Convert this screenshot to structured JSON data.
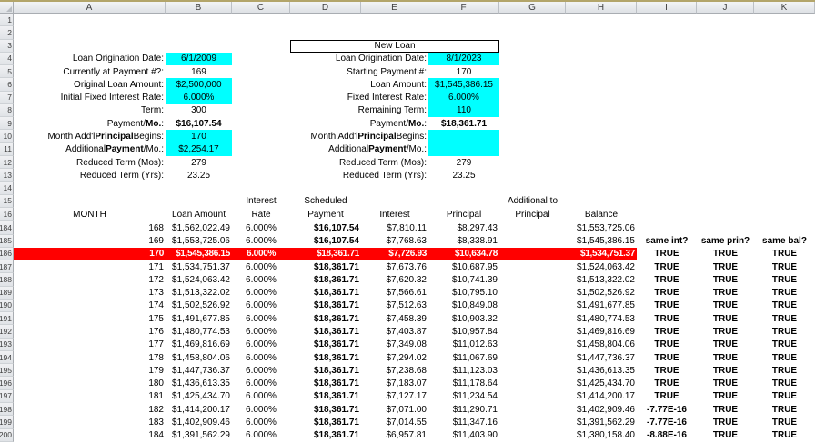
{
  "colors": {
    "highlight_cyan": "#00FFFF",
    "highlight_red": "#FF0000",
    "red_row_text": "#FFFFFF"
  },
  "grid_columns": [
    "A",
    "B",
    "C",
    "D",
    "E",
    "F",
    "G",
    "H",
    "I",
    "J",
    "K"
  ],
  "form_rows": [
    {
      "n": "1"
    },
    {
      "n": "2"
    },
    {
      "n": "3",
      "cells": [
        {
          "col": "D",
          "span": 3,
          "t": "New Loan",
          "align": "c",
          "box": true
        }
      ]
    },
    {
      "n": "4",
      "cells": [
        {
          "col": "A",
          "t": "Loan Origination Date:",
          "align": "r"
        },
        {
          "col": "B",
          "t": "6/1/2009",
          "align": "c",
          "bg": "cyan"
        },
        {
          "col": "D",
          "span": 2,
          "t": "Loan Origination Date:",
          "align": "r"
        },
        {
          "col": "F",
          "t": "8/1/2023",
          "align": "c",
          "bg": "cyan"
        }
      ]
    },
    {
      "n": "5",
      "cells": [
        {
          "col": "A",
          "t": "Currently at Payment #?:",
          "align": "r"
        },
        {
          "col": "B",
          "t": "169",
          "align": "c"
        },
        {
          "col": "D",
          "span": 2,
          "t": "Starting Payment #:",
          "align": "r"
        },
        {
          "col": "F",
          "t": "170",
          "align": "c"
        }
      ]
    },
    {
      "n": "6",
      "cells": [
        {
          "col": "A",
          "t": "Original Loan Amount:",
          "align": "r"
        },
        {
          "col": "B",
          "t": "$2,500,000",
          "align": "c",
          "bg": "cyan"
        },
        {
          "col": "D",
          "span": 2,
          "t": "Loan Amount:",
          "align": "r"
        },
        {
          "col": "F",
          "t": "$1,545,386.15",
          "align": "c",
          "bg": "cyan"
        }
      ]
    },
    {
      "n": "7",
      "cells": [
        {
          "col": "A",
          "t": "Initial Fixed Interest Rate:",
          "align": "r"
        },
        {
          "col": "B",
          "t": "6.000%",
          "align": "c",
          "bg": "cyan"
        },
        {
          "col": "D",
          "span": 2,
          "t": "Fixed Interest Rate:",
          "align": "r"
        },
        {
          "col": "F",
          "t": "6.000%",
          "align": "c",
          "bg": "cyan"
        }
      ]
    },
    {
      "n": "8",
      "cells": [
        {
          "col": "A",
          "t": "Term:",
          "align": "r"
        },
        {
          "col": "B",
          "t": "300",
          "align": "c"
        },
        {
          "col": "D",
          "span": 2,
          "t": "Remaining Term:",
          "align": "r"
        },
        {
          "col": "F",
          "t": "110",
          "align": "c",
          "bg": "cyan"
        }
      ]
    },
    {
      "n": "9",
      "cells": [
        {
          "col": "A",
          "parts": [
            {
              "t": "Payment/"
            },
            {
              "t": "Mo.",
              "b": true
            },
            {
              "t": ":"
            }
          ],
          "align": "r"
        },
        {
          "col": "B",
          "t": "$16,107.54",
          "align": "c",
          "bold": true
        },
        {
          "col": "D",
          "span": 2,
          "parts": [
            {
              "t": "Payment/"
            },
            {
              "t": "Mo.",
              "b": true
            },
            {
              "t": ":"
            }
          ],
          "align": "r"
        },
        {
          "col": "F",
          "t": "$18,361.71",
          "align": "c",
          "bold": true
        }
      ]
    },
    {
      "n": "10",
      "cells": [
        {
          "col": "A",
          "parts": [
            {
              "t": "Month Add'l "
            },
            {
              "t": "Principal",
              "b": true
            },
            {
              "t": " Begins:"
            }
          ],
          "align": "r"
        },
        {
          "col": "B",
          "t": "170",
          "align": "c",
          "bg": "cyan"
        },
        {
          "col": "D",
          "span": 2,
          "parts": [
            {
              "t": "Month Add'l "
            },
            {
              "t": "Principal",
              "b": true
            },
            {
              "t": " Begins:"
            }
          ],
          "align": "r"
        },
        {
          "col": "F",
          "t": "",
          "align": "c",
          "bg": "cyan"
        }
      ]
    },
    {
      "n": "11",
      "cells": [
        {
          "col": "A",
          "parts": [
            {
              "t": "Additional "
            },
            {
              "t": "Payment",
              "b": true
            },
            {
              "t": "/Mo.:"
            }
          ],
          "align": "r"
        },
        {
          "col": "B",
          "t": "$2,254.17",
          "align": "c",
          "bg": "cyan"
        },
        {
          "col": "D",
          "span": 2,
          "parts": [
            {
              "t": "Additional "
            },
            {
              "t": "Payment",
              "b": true
            },
            {
              "t": "/Mo.:"
            }
          ],
          "align": "r"
        },
        {
          "col": "F",
          "t": "",
          "align": "c",
          "bg": "cyan"
        }
      ]
    },
    {
      "n": "12",
      "cells": [
        {
          "col": "A",
          "t": "Reduced Term (Mos):",
          "align": "r"
        },
        {
          "col": "B",
          "t": "279",
          "align": "c"
        },
        {
          "col": "D",
          "span": 2,
          "t": "Reduced Term (Mos):",
          "align": "r"
        },
        {
          "col": "F",
          "t": "279",
          "align": "c"
        }
      ]
    },
    {
      "n": "13",
      "cells": [
        {
          "col": "A",
          "t": "Reduced Term (Yrs):",
          "align": "r"
        },
        {
          "col": "B",
          "t": "23.25",
          "align": "c"
        },
        {
          "col": "D",
          "span": 2,
          "t": "Reduced Term (Yrs):",
          "align": "r"
        },
        {
          "col": "F",
          "t": "23.25",
          "align": "c"
        }
      ]
    },
    {
      "n": "14"
    },
    {
      "n": "15",
      "cells": [
        {
          "col": "C",
          "t": "Interest",
          "align": "c"
        },
        {
          "col": "D",
          "t": "Scheduled",
          "align": "c"
        },
        {
          "col": "G",
          "t": "Additional to",
          "align": "c"
        }
      ]
    },
    {
      "n": "16",
      "cells": [
        {
          "col": "A",
          "t": "MONTH",
          "align": "c"
        },
        {
          "col": "B",
          "t": "Loan Amount",
          "align": "c"
        },
        {
          "col": "C",
          "t": "Rate",
          "align": "c"
        },
        {
          "col": "D",
          "t": "Payment",
          "align": "c"
        },
        {
          "col": "E",
          "t": "Interest",
          "align": "c"
        },
        {
          "col": "F",
          "t": "Principal",
          "align": "c"
        },
        {
          "col": "G",
          "t": "Principal",
          "align": "c"
        },
        {
          "col": "H",
          "t": "Balance",
          "align": "c"
        }
      ]
    }
  ],
  "amortization_rows": [
    {
      "n": "184",
      "month": "168",
      "loan": "$1,562,022.49",
      "rate": "6.000%",
      "payment": "$16,107.54",
      "interest": "$7,810.11",
      "principal": "$8,297.43",
      "balance": "$1,553,725.06",
      "same_int": "",
      "same_prin": "",
      "same_bal": ""
    },
    {
      "n": "185",
      "month": "169",
      "loan": "$1,553,725.06",
      "rate": "6.000%",
      "payment": "$16,107.54",
      "interest": "$7,768.63",
      "principal": "$8,338.91",
      "balance": "$1,545,386.15",
      "same_int": "same int?",
      "same_prin": "same prin?",
      "same_bal": "same bal?"
    },
    {
      "n": "186",
      "highlight": true,
      "month": "170",
      "loan": "$1,545,386.15",
      "rate": "6.000%",
      "payment": "$18,361.71",
      "interest": "$7,726.93",
      "principal": "$10,634.78",
      "balance": "$1,534,751.37",
      "same_int": "TRUE",
      "same_prin": "TRUE",
      "same_bal": "TRUE"
    },
    {
      "n": "187",
      "month": "171",
      "loan": "$1,534,751.37",
      "rate": "6.000%",
      "payment": "$18,361.71",
      "interest": "$7,673.76",
      "principal": "$10,687.95",
      "balance": "$1,524,063.42",
      "same_int": "TRUE",
      "same_prin": "TRUE",
      "same_bal": "TRUE"
    },
    {
      "n": "188",
      "month": "172",
      "loan": "$1,524,063.42",
      "rate": "6.000%",
      "payment": "$18,361.71",
      "interest": "$7,620.32",
      "principal": "$10,741.39",
      "balance": "$1,513,322.02",
      "same_int": "TRUE",
      "same_prin": "TRUE",
      "same_bal": "TRUE"
    },
    {
      "n": "189",
      "month": "173",
      "loan": "$1,513,322.02",
      "rate": "6.000%",
      "payment": "$18,361.71",
      "interest": "$7,566.61",
      "principal": "$10,795.10",
      "balance": "$1,502,526.92",
      "same_int": "TRUE",
      "same_prin": "TRUE",
      "same_bal": "TRUE"
    },
    {
      "n": "190",
      "month": "174",
      "loan": "$1,502,526.92",
      "rate": "6.000%",
      "payment": "$18,361.71",
      "interest": "$7,512.63",
      "principal": "$10,849.08",
      "balance": "$1,491,677.85",
      "same_int": "TRUE",
      "same_prin": "TRUE",
      "same_bal": "TRUE"
    },
    {
      "n": "191",
      "month": "175",
      "loan": "$1,491,677.85",
      "rate": "6.000%",
      "payment": "$18,361.71",
      "interest": "$7,458.39",
      "principal": "$10,903.32",
      "balance": "$1,480,774.53",
      "same_int": "TRUE",
      "same_prin": "TRUE",
      "same_bal": "TRUE"
    },
    {
      "n": "192",
      "month": "176",
      "loan": "$1,480,774.53",
      "rate": "6.000%",
      "payment": "$18,361.71",
      "interest": "$7,403.87",
      "principal": "$10,957.84",
      "balance": "$1,469,816.69",
      "same_int": "TRUE",
      "same_prin": "TRUE",
      "same_bal": "TRUE"
    },
    {
      "n": "193",
      "month": "177",
      "loan": "$1,469,816.69",
      "rate": "6.000%",
      "payment": "$18,361.71",
      "interest": "$7,349.08",
      "principal": "$11,012.63",
      "balance": "$1,458,804.06",
      "same_int": "TRUE",
      "same_prin": "TRUE",
      "same_bal": "TRUE"
    },
    {
      "n": "194",
      "month": "178",
      "loan": "$1,458,804.06",
      "rate": "6.000%",
      "payment": "$18,361.71",
      "interest": "$7,294.02",
      "principal": "$11,067.69",
      "balance": "$1,447,736.37",
      "same_int": "TRUE",
      "same_prin": "TRUE",
      "same_bal": "TRUE"
    },
    {
      "n": "195",
      "month": "179",
      "loan": "$1,447,736.37",
      "rate": "6.000%",
      "payment": "$18,361.71",
      "interest": "$7,238.68",
      "principal": "$11,123.03",
      "balance": "$1,436,613.35",
      "same_int": "TRUE",
      "same_prin": "TRUE",
      "same_bal": "TRUE"
    },
    {
      "n": "196",
      "month": "180",
      "loan": "$1,436,613.35",
      "rate": "6.000%",
      "payment": "$18,361.71",
      "interest": "$7,183.07",
      "principal": "$11,178.64",
      "balance": "$1,425,434.70",
      "same_int": "TRUE",
      "same_prin": "TRUE",
      "same_bal": "TRUE"
    },
    {
      "n": "197",
      "month": "181",
      "loan": "$1,425,434.70",
      "rate": "6.000%",
      "payment": "$18,361.71",
      "interest": "$7,127.17",
      "principal": "$11,234.54",
      "balance": "$1,414,200.17",
      "same_int": "TRUE",
      "same_prin": "TRUE",
      "same_bal": "TRUE"
    },
    {
      "n": "198",
      "month": "182",
      "loan": "$1,414,200.17",
      "rate": "6.000%",
      "payment": "$18,361.71",
      "interest": "$7,071.00",
      "principal": "$11,290.71",
      "balance": "$1,402,909.46",
      "same_int": "-7.77E-16",
      "same_prin": "TRUE",
      "same_bal": "TRUE"
    },
    {
      "n": "199",
      "month": "183",
      "loan": "$1,402,909.46",
      "rate": "6.000%",
      "payment": "$18,361.71",
      "interest": "$7,014.55",
      "principal": "$11,347.16",
      "balance": "$1,391,562.29",
      "same_int": "-7.77E-16",
      "same_prin": "TRUE",
      "same_bal": "TRUE"
    },
    {
      "n": "200",
      "month": "184",
      "loan": "$1,391,562.29",
      "rate": "6.000%",
      "payment": "$18,361.71",
      "interest": "$6,957.81",
      "principal": "$11,403.90",
      "balance": "$1,380,158.40",
      "same_int": "-8.88E-16",
      "same_prin": "TRUE",
      "same_bal": "TRUE"
    }
  ]
}
